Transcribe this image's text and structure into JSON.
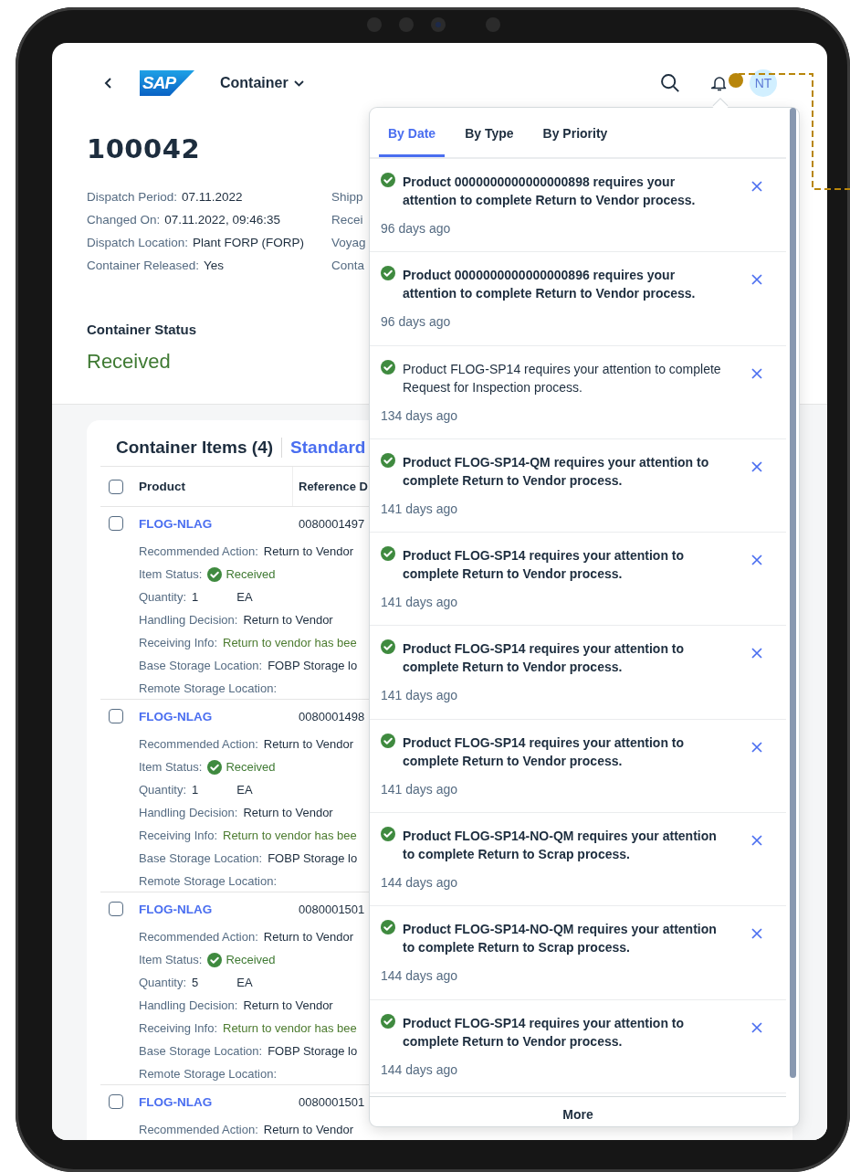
{
  "header": {
    "logo": "SAP",
    "title": "Container",
    "avatar": "NT"
  },
  "object": {
    "title": "100042",
    "attributes": [
      {
        "label": "Dispatch Period:",
        "value": "07.11.2022"
      },
      {
        "label": "Changed On:",
        "value": "07.11.2022, 09:46:35"
      },
      {
        "label": "Dispatch Location:",
        "value": "Plant FORP (FORP)"
      },
      {
        "label": "Container Released:",
        "value": "Yes"
      }
    ],
    "attributes_2": [
      "Shipp",
      "Recei",
      "Voyag",
      "Conta"
    ],
    "status_label": "Container Status",
    "status": "Received"
  },
  "items_table": {
    "title": "Container Items (4)",
    "variant": "Standard",
    "select_all": {
      "checked": false
    },
    "columns": [
      "Product",
      "Reference D"
    ],
    "rows": [
      {
        "checked": false,
        "product": "FLOG-NLAG",
        "reference": "0080001497",
        "fields": [
          {
            "kind": "text",
            "label": "Recommended Action:",
            "value": "Return to Vendor"
          },
          {
            "kind": "status",
            "label": "Item Status:",
            "value": "Received"
          },
          {
            "kind": "quantity",
            "label": "Quantity:",
            "value": "1",
            "unit": "EA"
          },
          {
            "kind": "text",
            "label": "Handling Decision:",
            "value": "Return to Vendor"
          },
          {
            "kind": "info",
            "label": "Receiving Info:",
            "value": "Return to vendor has bee"
          },
          {
            "kind": "text",
            "label": "Base Storage Location:",
            "value": "FOBP Storage lo"
          },
          {
            "kind": "text",
            "label": "Remote Storage Location:"
          }
        ]
      },
      {
        "checked": false,
        "product": "FLOG-NLAG",
        "reference": "0080001498",
        "fields": [
          {
            "kind": "text",
            "label": "Recommended Action:",
            "value": "Return to Vendor"
          },
          {
            "kind": "status",
            "label": "Item Status:",
            "value": "Received"
          },
          {
            "kind": "quantity",
            "label": "Quantity:",
            "value": "1",
            "unit": "EA"
          },
          {
            "kind": "text",
            "label": "Handling Decision:",
            "value": "Return to Vendor"
          },
          {
            "kind": "info",
            "label": "Receiving Info:",
            "value": "Return to vendor has bee"
          },
          {
            "kind": "text",
            "label": "Base Storage Location:",
            "value": "FOBP Storage lo"
          },
          {
            "kind": "text",
            "label": "Remote Storage Location:"
          }
        ]
      },
      {
        "checked": false,
        "product": "FLOG-NLAG",
        "reference": "0080001501",
        "fields": [
          {
            "kind": "text",
            "label": "Recommended Action:",
            "value": "Return to Vendor"
          },
          {
            "kind": "status",
            "label": "Item Status:",
            "value": "Received"
          },
          {
            "kind": "quantity",
            "label": "Quantity:",
            "value": "5",
            "unit": "EA"
          },
          {
            "kind": "text",
            "label": "Handling Decision:",
            "value": "Return to Vendor"
          },
          {
            "kind": "info",
            "label": "Receiving Info:",
            "value": "Return to vendor has bee"
          },
          {
            "kind": "text",
            "label": "Base Storage Location:",
            "value": "FOBP Storage lo"
          },
          {
            "kind": "text",
            "label": "Remote Storage Location:"
          }
        ]
      },
      {
        "checked": false,
        "product": "FLOG-NLAG",
        "reference": "0080001501",
        "fields": [
          {
            "kind": "text",
            "label": "Recommended Action:",
            "value": "Return to Vendor"
          }
        ]
      }
    ]
  },
  "notifications": {
    "tabs": [
      {
        "label": "By Date",
        "selected": true
      },
      {
        "label": "By Type",
        "selected": false
      },
      {
        "label": "By Priority",
        "selected": false
      }
    ],
    "items": [
      {
        "text": "Product 0000000000000000898 requires your attention to complete Return to Vendor process.",
        "unread": true,
        "time": "96 days ago"
      },
      {
        "text": "Product 0000000000000000896 requires your attention to complete Return to Vendor process.",
        "unread": true,
        "time": "96 days ago"
      },
      {
        "text": "Product FLOG-SP14 requires your attention to complete Request for Inspection process.",
        "unread": false,
        "time": "134 days ago"
      },
      {
        "text": "Product FLOG-SP14-QM requires your attention to complete Return to Vendor process.",
        "unread": true,
        "time": "141 days ago"
      },
      {
        "text": "Product FLOG-SP14 requires your attention to complete Return to Vendor process.",
        "unread": true,
        "time": "141 days ago"
      },
      {
        "text": "Product FLOG-SP14 requires your attention to complete Return to Vendor process.",
        "unread": true,
        "time": "141 days ago"
      },
      {
        "text": "Product FLOG-SP14 requires your attention to complete Return to Vendor process.",
        "unread": true,
        "time": "141 days ago"
      },
      {
        "text": "Product FLOG-SP14-NO-QM requires your attention to complete Return to Scrap process.",
        "unread": true,
        "time": "144 days ago"
      },
      {
        "text": "Product FLOG-SP14-NO-QM requires your attention to complete Return to Scrap process.",
        "unread": true,
        "time": "144 days ago"
      },
      {
        "text": "Product FLOG-SP14 requires your attention to complete Return to Vendor process.",
        "unread": true,
        "time": "144 days ago"
      }
    ],
    "more": "More"
  }
}
